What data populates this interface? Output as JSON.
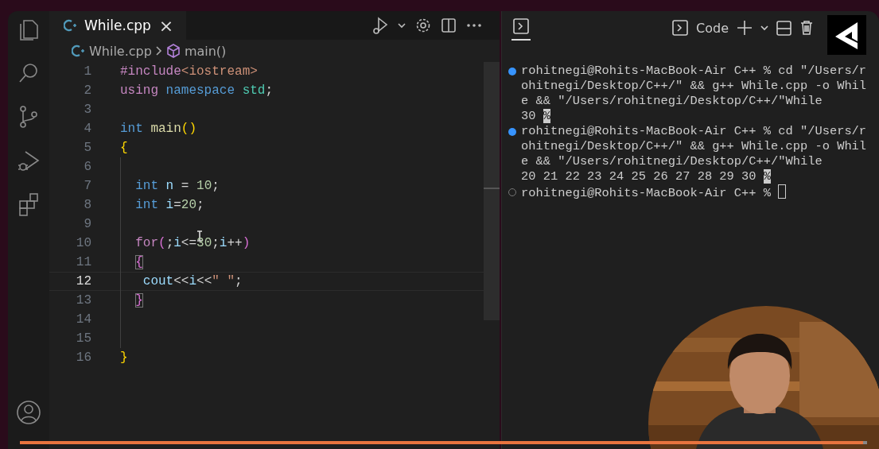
{
  "editor": {
    "tab": {
      "label": "While.cpp",
      "close": "×"
    },
    "breadcrumb": [
      "While.cpp",
      "main()"
    ],
    "lines": [
      {
        "number": "1",
        "current": false,
        "guide": false,
        "tokens": [
          {
            "kind": "preproc",
            "text": "#include"
          },
          {
            "kind": "string",
            "text": "<iostream>"
          }
        ]
      },
      {
        "number": "2",
        "current": false,
        "guide": false,
        "tokens": [
          {
            "kind": "keyword",
            "text": "using "
          },
          {
            "kind": "type",
            "text": "namespace "
          },
          {
            "kind": "name",
            "text": "std"
          },
          {
            "kind": "plain",
            "text": ";"
          }
        ]
      },
      {
        "number": "3",
        "current": false,
        "guide": false
      },
      {
        "number": "4",
        "current": false,
        "guide": false,
        "tokens": [
          {
            "kind": "type",
            "text": "int "
          },
          {
            "kind": "func",
            "text": "main"
          },
          {
            "kind": "bracket1",
            "text": "()"
          }
        ]
      },
      {
        "number": "5",
        "current": false,
        "guide": false,
        "tokens": [
          {
            "kind": "bracket1",
            "text": "{"
          }
        ]
      },
      {
        "number": "6",
        "current": false,
        "guide": true
      },
      {
        "number": "7",
        "current": false,
        "guide": true,
        "tokens": [
          {
            "kind": "type",
            "text": "  int "
          },
          {
            "kind": "var",
            "text": "n"
          },
          {
            "kind": "plain",
            "text": " = "
          },
          {
            "kind": "number",
            "text": "10"
          },
          {
            "kind": "plain",
            "text": ";"
          }
        ]
      },
      {
        "number": "8",
        "current": false,
        "guide": true,
        "tokens": [
          {
            "kind": "type",
            "text": "  int "
          },
          {
            "kind": "var",
            "text": "i"
          },
          {
            "kind": "plain",
            "text": "="
          },
          {
            "kind": "number",
            "text": "20"
          },
          {
            "kind": "plain",
            "text": ";"
          }
        ]
      },
      {
        "number": "9",
        "current": false,
        "guide": true
      },
      {
        "number": "10",
        "current": false,
        "guide": true,
        "tokens": [
          {
            "kind": "keyword",
            "text": "  for"
          },
          {
            "kind": "bracket2",
            "text": "("
          },
          {
            "kind": "plain",
            "text": ";"
          },
          {
            "kind": "var",
            "text": "i"
          },
          {
            "kind": "plain",
            "text": "<="
          },
          {
            "kind": "number",
            "text": "30"
          },
          {
            "kind": "plain",
            "text": ";"
          },
          {
            "kind": "var",
            "text": "i"
          },
          {
            "kind": "plain",
            "text": "++"
          },
          {
            "kind": "bracket2",
            "text": ")"
          }
        ]
      },
      {
        "number": "11",
        "current": false,
        "guide": true,
        "tokens": [
          {
            "kind": "matched",
            "text": "  {"
          }
        ]
      },
      {
        "number": "12",
        "current": true,
        "guide": true,
        "tokens": [
          {
            "kind": "var",
            "text": "   cout"
          },
          {
            "kind": "plain",
            "text": "<<"
          },
          {
            "kind": "var",
            "text": "i"
          },
          {
            "kind": "plain",
            "text": "<<"
          },
          {
            "kind": "string",
            "text": "\" \""
          },
          {
            "kind": "plain",
            "text": ";"
          }
        ]
      },
      {
        "number": "13",
        "current": false,
        "guide": true,
        "tokens": [
          {
            "kind": "matched",
            "text": "  }"
          }
        ]
      },
      {
        "number": "14",
        "current": false,
        "guide": true
      },
      {
        "number": "15",
        "current": false,
        "guide": true
      },
      {
        "number": "16",
        "current": false,
        "guide": false,
        "tokens": [
          {
            "kind": "bracket1",
            "text": "}"
          }
        ]
      }
    ]
  },
  "terminal": {
    "toolbar_label": "Code",
    "entries": [
      {
        "done": true,
        "lines": [
          "rohitnegi@Rohits-MacBook-Air C++ % cd \"/Users/r",
          "ohitnegi/Desktop/C++/\" && g++ While.cpp -o Whil",
          "e && \"/Users/rohitnegi/Desktop/C++/\"While"
        ],
        "output": "30",
        "end_mark": "%"
      },
      {
        "done": true,
        "lines": [
          "rohitnegi@Rohits-MacBook-Air C++ % cd \"/Users/r",
          "ohitnegi/Desktop/C++/\" && g++ While.cpp -o Whil",
          "e && \"/Users/rohitnegi/Desktop/C++/\"While"
        ],
        "output": "20 21 22 23 24 25 26 27 28 29 30",
        "end_mark": "%"
      },
      {
        "done": false,
        "lines": [
          "rohitnegi@Rohits-MacBook-Air C++ %"
        ]
      }
    ]
  },
  "video": {
    "progress": {
      "level": 0.995
    }
  }
}
